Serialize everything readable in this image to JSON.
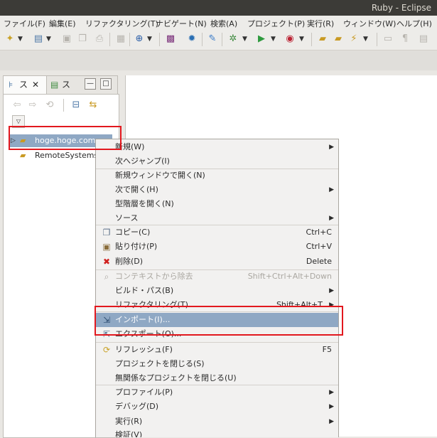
{
  "window": {
    "title": "Ruby - Eclipse"
  },
  "menubar": [
    "ファイル(F)",
    "編集(E)",
    "リファクタリング(T)",
    "ナビゲート(N)",
    "検索(A)",
    "プロジェクト(P)",
    "実行(R)",
    "ウィンドウ(W)",
    "ヘルプ(H)"
  ],
  "view": {
    "tab1": "ス",
    "tab2": "ス"
  },
  "tree": {
    "item1": "hoge.hoge.com",
    "item2": "RemoteSystems"
  },
  "context_menu": {
    "new": "新規(W)",
    "go_into": "次へジャンプ(I)",
    "open_new_window": "新規ウィンドウで開く(N)",
    "open_with": "次で開く(H)",
    "open_type_hierarchy": "型階層を開く(N)",
    "source": "ソース",
    "copy": "コピー(C)",
    "copy_sc": "Ctrl+C",
    "paste": "貼り付け(P)",
    "paste_sc": "Ctrl+V",
    "delete": "削除(D)",
    "delete_sc": "Delete",
    "remove_ctx": "コンテキストから除去",
    "remove_ctx_sc": "Shift+Ctrl+Alt+Down",
    "build_path": "ビルド・パス(B)",
    "refactor": "リファクタリング(T)",
    "refactor_sc": "Shift+Alt+T",
    "import": "インポート(I)...",
    "export": "エクスポート(O)...",
    "refresh": "リフレッシュ(F)",
    "refresh_sc": "F5",
    "close_project": "プロジェクトを閉じる(S)",
    "close_unrelated": "無関係なプロジェクトを閉じる(U)",
    "profile": "プロファイル(P)",
    "debug": "デバッグ(D)",
    "run": "実行(R)",
    "validate": "検証(V)"
  }
}
